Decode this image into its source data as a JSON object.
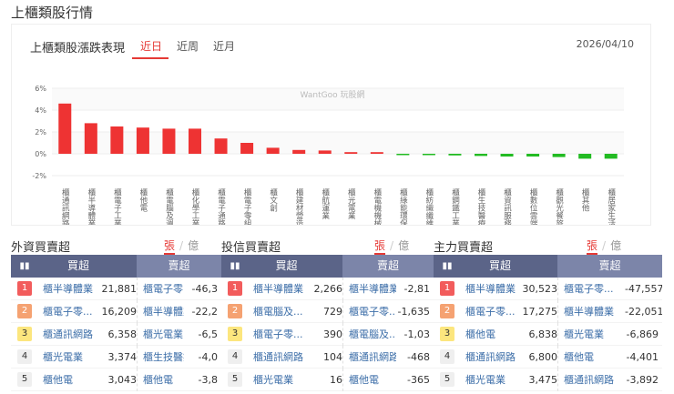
{
  "page_title": "上櫃類股行情",
  "chart_card": {
    "title": "上櫃類股漲跌表現",
    "tabs": [
      "近日",
      "近周",
      "近月"
    ],
    "active_tab": 0,
    "date": "2026/04/10",
    "watermark": "WantGoo 玩股網"
  },
  "chart_data": {
    "type": "bar",
    "ylim": [
      -2,
      6
    ],
    "yticks": [
      "6%",
      "4%",
      "2%",
      "0%",
      "-2%"
    ],
    "ytick_values": [
      6,
      4,
      2,
      0,
      -2
    ],
    "categories": [
      "櫃通訊網路",
      "櫃半導體業",
      "櫃電子工業",
      "櫃他電",
      "櫃電腦及週邊設備",
      "櫃化學工業",
      "櫃電子通路",
      "櫃電子零組件業",
      "櫃文創",
      "櫃建材營造",
      "櫃航運業",
      "櫃光電業",
      "櫃電機機械",
      "櫃綠能環保",
      "櫃紡織纖維",
      "櫃鋼鐵工業",
      "櫃生技醫療",
      "櫃資訊服務業",
      "櫃數位雲端",
      "櫃觀光餐旅",
      "櫃其他",
      "櫃居家生活"
    ],
    "values": [
      4.6,
      2.8,
      2.5,
      2.4,
      2.3,
      2.3,
      1.4,
      1.0,
      0.55,
      0.35,
      0.3,
      0.15,
      0.15,
      -0.05,
      -0.1,
      -0.15,
      -0.2,
      -0.25,
      -0.25,
      -0.3,
      -0.45,
      -0.45
    ],
    "colors": {
      "up": "#ee3333",
      "down": "#22bb22"
    }
  },
  "sections": [
    {
      "title": "外資買賣超",
      "unit_on": "張",
      "unit_off": "億",
      "buy_header": "買超",
      "sell_header": "賣超",
      "buy": [
        {
          "name": "櫃半導體業",
          "value": "21,881"
        },
        {
          "name": "櫃電子零...",
          "value": "16,209"
        },
        {
          "name": "櫃通訊網路",
          "value": "6,358"
        },
        {
          "name": "櫃光電業",
          "value": "3,374"
        },
        {
          "name": "櫃他電",
          "value": "3,043"
        }
      ],
      "sell": [
        {
          "name": "櫃電子零...",
          "value": "-46,3"
        },
        {
          "name": "櫃半導體業",
          "value": "-22,2"
        },
        {
          "name": "櫃光電業",
          "value": "-6,5"
        },
        {
          "name": "櫃生技醫療",
          "value": "-4,0"
        },
        {
          "name": "櫃他電",
          "value": "-3,8"
        }
      ]
    },
    {
      "title": "投信買賣超",
      "unit_on": "張",
      "unit_off": "億",
      "buy_header": "買超",
      "sell_header": "賣超",
      "buy": [
        {
          "name": "櫃半導體業",
          "value": "2,266"
        },
        {
          "name": "櫃電腦及...",
          "value": "729"
        },
        {
          "name": "櫃電子零...",
          "value": "390"
        },
        {
          "name": "櫃通訊網路",
          "value": "104"
        },
        {
          "name": "櫃光電業",
          "value": "16"
        }
      ],
      "sell": [
        {
          "name": "櫃半導體業",
          "value": "-2,81"
        },
        {
          "name": "櫃電子零...",
          "value": "-1,635"
        },
        {
          "name": "櫃電腦及...",
          "value": "-1,03"
        },
        {
          "name": "櫃通訊網路",
          "value": "-468"
        },
        {
          "name": "櫃他電",
          "value": "-365"
        }
      ]
    },
    {
      "title": "主力買賣超",
      "unit_on": "張",
      "unit_off": "億",
      "buy_header": "買超",
      "sell_header": "賣超",
      "buy": [
        {
          "name": "櫃半導體業",
          "value": "30,523"
        },
        {
          "name": "櫃電子零...",
          "value": "17,275"
        },
        {
          "name": "櫃他電",
          "value": "6,838"
        },
        {
          "name": "櫃通訊網路",
          "value": "6,800"
        },
        {
          "name": "櫃光電業",
          "value": "3,475"
        }
      ],
      "sell": [
        {
          "name": "櫃電子零...",
          "value": "-47,557"
        },
        {
          "name": "櫃半導體業",
          "value": "-22,051"
        },
        {
          "name": "櫃光電業",
          "value": "-6,869"
        },
        {
          "name": "櫃他電",
          "value": "-4,401"
        },
        {
          "name": "櫃通訊網路",
          "value": "-3,892"
        }
      ]
    }
  ]
}
